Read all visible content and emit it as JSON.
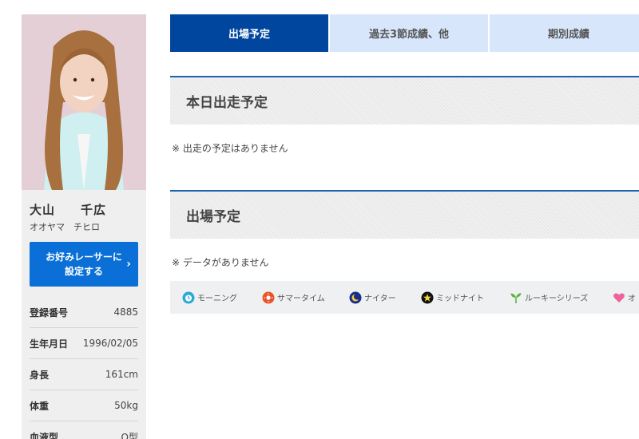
{
  "profile": {
    "name_kanji": "大山　　千広",
    "name_kana": "オオヤマ　チヒロ",
    "favorite_button": "お好みレーサーに設定する",
    "info": [
      {
        "label": "登録番号",
        "value": "4885"
      },
      {
        "label": "生年月日",
        "value": "1996/02/05"
      },
      {
        "label": "身長",
        "value": "161cm"
      },
      {
        "label": "体重",
        "value": "50kg"
      },
      {
        "label": "血液型",
        "value": "O型"
      }
    ]
  },
  "tabs": [
    {
      "label": "出場予定",
      "active": true
    },
    {
      "label": "過去3節成績、他",
      "active": false
    },
    {
      "label": "期別成績",
      "active": false
    }
  ],
  "sections": {
    "today": {
      "title": "本日出走予定",
      "note": "※ 出走の予定はありません"
    },
    "schedule": {
      "title": "出場予定",
      "note": "※ データがありません"
    }
  },
  "legend": [
    {
      "label": "モーニング",
      "icon": "alarm-clock-icon",
      "color": "#2aa9d6"
    },
    {
      "label": "サマータイム",
      "icon": "sun-icon",
      "color": "#e8542a"
    },
    {
      "label": "ナイター",
      "icon": "moon-icon",
      "color": "#1a2f8a"
    },
    {
      "label": "ミッドナイト",
      "icon": "star-icon",
      "color": "#111111"
    },
    {
      "label": "ルーキーシリーズ",
      "icon": "sprout-icon",
      "color": "#5bb540"
    },
    {
      "label": "オ",
      "icon": "heart-icon",
      "color": "#f0609a"
    }
  ]
}
